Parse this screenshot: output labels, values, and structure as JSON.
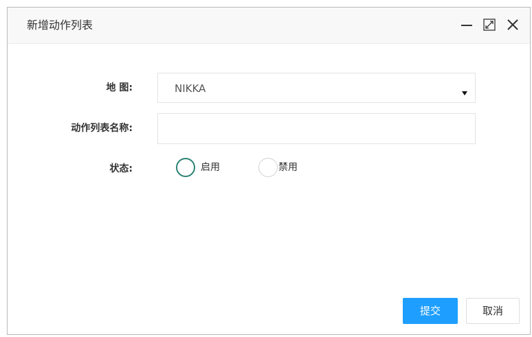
{
  "dialog": {
    "title": "新增动作列表",
    "controls": {
      "minimize_icon": "minimize-icon",
      "maximize_icon": "maximize-icon",
      "close_icon": "close-icon"
    }
  },
  "form": {
    "map": {
      "label": "地 图:",
      "selected": "NIKKA"
    },
    "name": {
      "label": "动作列表名称:",
      "value": "",
      "placeholder": ""
    },
    "status": {
      "label": "状态:",
      "options": [
        {
          "label": "启用",
          "checked": true
        },
        {
          "label": "禁用",
          "checked": false
        }
      ]
    }
  },
  "buttons": {
    "submit": "提交",
    "cancel": "取消"
  },
  "colors": {
    "primary": "#1e9fff",
    "radio_active": "#2b8273",
    "border": "#e3e3e3"
  }
}
